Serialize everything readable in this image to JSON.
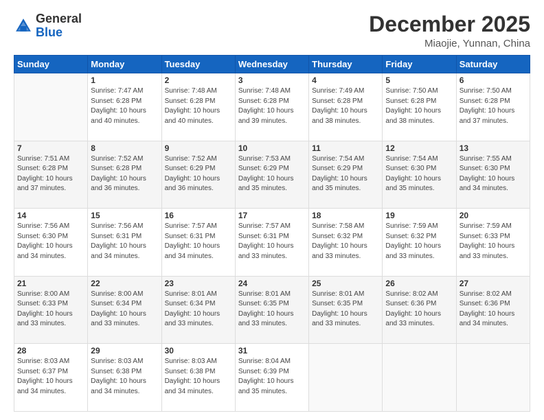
{
  "header": {
    "logo_line1": "General",
    "logo_line2": "Blue",
    "title": "December 2025",
    "subtitle": "Miaojie, Yunnan, China"
  },
  "days_of_week": [
    "Sunday",
    "Monday",
    "Tuesday",
    "Wednesday",
    "Thursday",
    "Friday",
    "Saturday"
  ],
  "weeks": [
    [
      {
        "day": "",
        "info": ""
      },
      {
        "day": "1",
        "info": "Sunrise: 7:47 AM\nSunset: 6:28 PM\nDaylight: 10 hours\nand 40 minutes."
      },
      {
        "day": "2",
        "info": "Sunrise: 7:48 AM\nSunset: 6:28 PM\nDaylight: 10 hours\nand 40 minutes."
      },
      {
        "day": "3",
        "info": "Sunrise: 7:48 AM\nSunset: 6:28 PM\nDaylight: 10 hours\nand 39 minutes."
      },
      {
        "day": "4",
        "info": "Sunrise: 7:49 AM\nSunset: 6:28 PM\nDaylight: 10 hours\nand 38 minutes."
      },
      {
        "day": "5",
        "info": "Sunrise: 7:50 AM\nSunset: 6:28 PM\nDaylight: 10 hours\nand 38 minutes."
      },
      {
        "day": "6",
        "info": "Sunrise: 7:50 AM\nSunset: 6:28 PM\nDaylight: 10 hours\nand 37 minutes."
      }
    ],
    [
      {
        "day": "7",
        "info": "Sunrise: 7:51 AM\nSunset: 6:28 PM\nDaylight: 10 hours\nand 37 minutes."
      },
      {
        "day": "8",
        "info": "Sunrise: 7:52 AM\nSunset: 6:28 PM\nDaylight: 10 hours\nand 36 minutes."
      },
      {
        "day": "9",
        "info": "Sunrise: 7:52 AM\nSunset: 6:29 PM\nDaylight: 10 hours\nand 36 minutes."
      },
      {
        "day": "10",
        "info": "Sunrise: 7:53 AM\nSunset: 6:29 PM\nDaylight: 10 hours\nand 35 minutes."
      },
      {
        "day": "11",
        "info": "Sunrise: 7:54 AM\nSunset: 6:29 PM\nDaylight: 10 hours\nand 35 minutes."
      },
      {
        "day": "12",
        "info": "Sunrise: 7:54 AM\nSunset: 6:30 PM\nDaylight: 10 hours\nand 35 minutes."
      },
      {
        "day": "13",
        "info": "Sunrise: 7:55 AM\nSunset: 6:30 PM\nDaylight: 10 hours\nand 34 minutes."
      }
    ],
    [
      {
        "day": "14",
        "info": "Sunrise: 7:56 AM\nSunset: 6:30 PM\nDaylight: 10 hours\nand 34 minutes."
      },
      {
        "day": "15",
        "info": "Sunrise: 7:56 AM\nSunset: 6:31 PM\nDaylight: 10 hours\nand 34 minutes."
      },
      {
        "day": "16",
        "info": "Sunrise: 7:57 AM\nSunset: 6:31 PM\nDaylight: 10 hours\nand 34 minutes."
      },
      {
        "day": "17",
        "info": "Sunrise: 7:57 AM\nSunset: 6:31 PM\nDaylight: 10 hours\nand 33 minutes."
      },
      {
        "day": "18",
        "info": "Sunrise: 7:58 AM\nSunset: 6:32 PM\nDaylight: 10 hours\nand 33 minutes."
      },
      {
        "day": "19",
        "info": "Sunrise: 7:59 AM\nSunset: 6:32 PM\nDaylight: 10 hours\nand 33 minutes."
      },
      {
        "day": "20",
        "info": "Sunrise: 7:59 AM\nSunset: 6:33 PM\nDaylight: 10 hours\nand 33 minutes."
      }
    ],
    [
      {
        "day": "21",
        "info": "Sunrise: 8:00 AM\nSunset: 6:33 PM\nDaylight: 10 hours\nand 33 minutes."
      },
      {
        "day": "22",
        "info": "Sunrise: 8:00 AM\nSunset: 6:34 PM\nDaylight: 10 hours\nand 33 minutes."
      },
      {
        "day": "23",
        "info": "Sunrise: 8:01 AM\nSunset: 6:34 PM\nDaylight: 10 hours\nand 33 minutes."
      },
      {
        "day": "24",
        "info": "Sunrise: 8:01 AM\nSunset: 6:35 PM\nDaylight: 10 hours\nand 33 minutes."
      },
      {
        "day": "25",
        "info": "Sunrise: 8:01 AM\nSunset: 6:35 PM\nDaylight: 10 hours\nand 33 minutes."
      },
      {
        "day": "26",
        "info": "Sunrise: 8:02 AM\nSunset: 6:36 PM\nDaylight: 10 hours\nand 33 minutes."
      },
      {
        "day": "27",
        "info": "Sunrise: 8:02 AM\nSunset: 6:36 PM\nDaylight: 10 hours\nand 34 minutes."
      }
    ],
    [
      {
        "day": "28",
        "info": "Sunrise: 8:03 AM\nSunset: 6:37 PM\nDaylight: 10 hours\nand 34 minutes."
      },
      {
        "day": "29",
        "info": "Sunrise: 8:03 AM\nSunset: 6:38 PM\nDaylight: 10 hours\nand 34 minutes."
      },
      {
        "day": "30",
        "info": "Sunrise: 8:03 AM\nSunset: 6:38 PM\nDaylight: 10 hours\nand 34 minutes."
      },
      {
        "day": "31",
        "info": "Sunrise: 8:04 AM\nSunset: 6:39 PM\nDaylight: 10 hours\nand 35 minutes."
      },
      {
        "day": "",
        "info": ""
      },
      {
        "day": "",
        "info": ""
      },
      {
        "day": "",
        "info": ""
      }
    ]
  ]
}
